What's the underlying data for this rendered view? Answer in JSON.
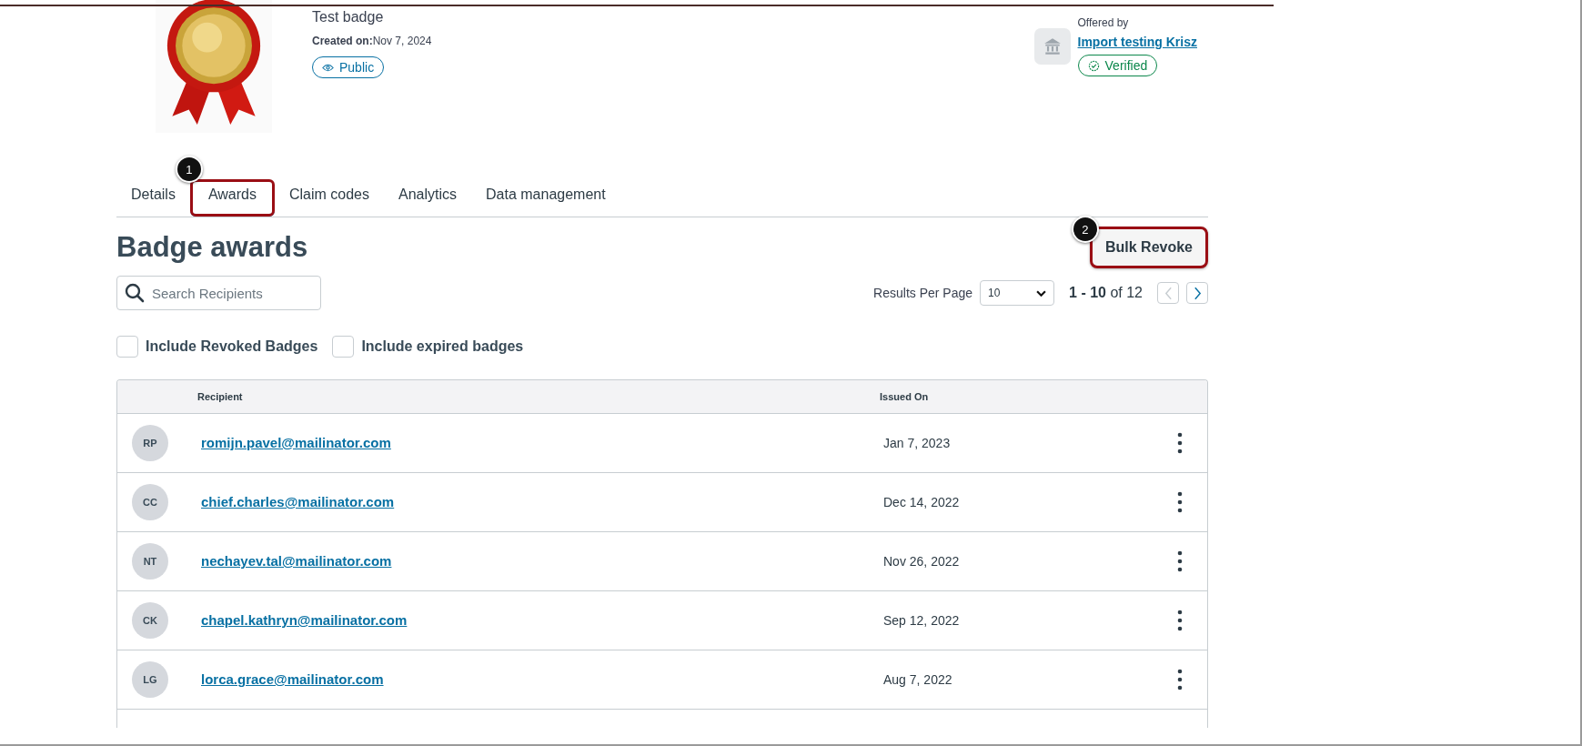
{
  "badge": {
    "name": "Test badge",
    "created_label": "Created on:",
    "created_date": "Nov 7, 2024",
    "visibility": "Public"
  },
  "issuer": {
    "label": "Offered by",
    "name": "Import testing Krisz",
    "status": "Verified"
  },
  "tabs": [
    {
      "label": "Details",
      "selected": false
    },
    {
      "label": "Awards",
      "selected": true,
      "callout": "1"
    },
    {
      "label": "Claim codes",
      "selected": false
    },
    {
      "label": "Analytics",
      "selected": false
    },
    {
      "label": "Data management",
      "selected": false
    }
  ],
  "heading": "Badge awards",
  "bulk_revoke": {
    "label": "Bulk Revoke",
    "callout": "2"
  },
  "search": {
    "placeholder": "Search Recipients"
  },
  "pagination": {
    "per_page_label": "Results Per Page",
    "per_page": "10",
    "range": "**1 - 10** of 12",
    "prev_disabled": true,
    "next_disabled": false
  },
  "filters": [
    {
      "label": "Include Revoked Badges",
      "checked": false
    },
    {
      "label": "Include expired badges",
      "checked": false
    }
  ],
  "table": {
    "columns": [
      "Recipient",
      "Issued On"
    ],
    "rows": [
      {
        "initials": "RP",
        "email": "romijn.pavel@mailinator.com",
        "issued": "Jan 7, 2023"
      },
      {
        "initials": "CC",
        "email": "chief.charles@mailinator.com",
        "issued": "Dec 14, 2022"
      },
      {
        "initials": "NT",
        "email": "nechayev.tal@mailinator.com",
        "issued": "Nov 26, 2022"
      },
      {
        "initials": "CK",
        "email": "chapel.kathryn@mailinator.com",
        "issued": "Sep 12, 2022"
      },
      {
        "initials": "LG",
        "email": "lorca.grace@mailinator.com",
        "issued": "Aug 7, 2022"
      }
    ]
  }
}
